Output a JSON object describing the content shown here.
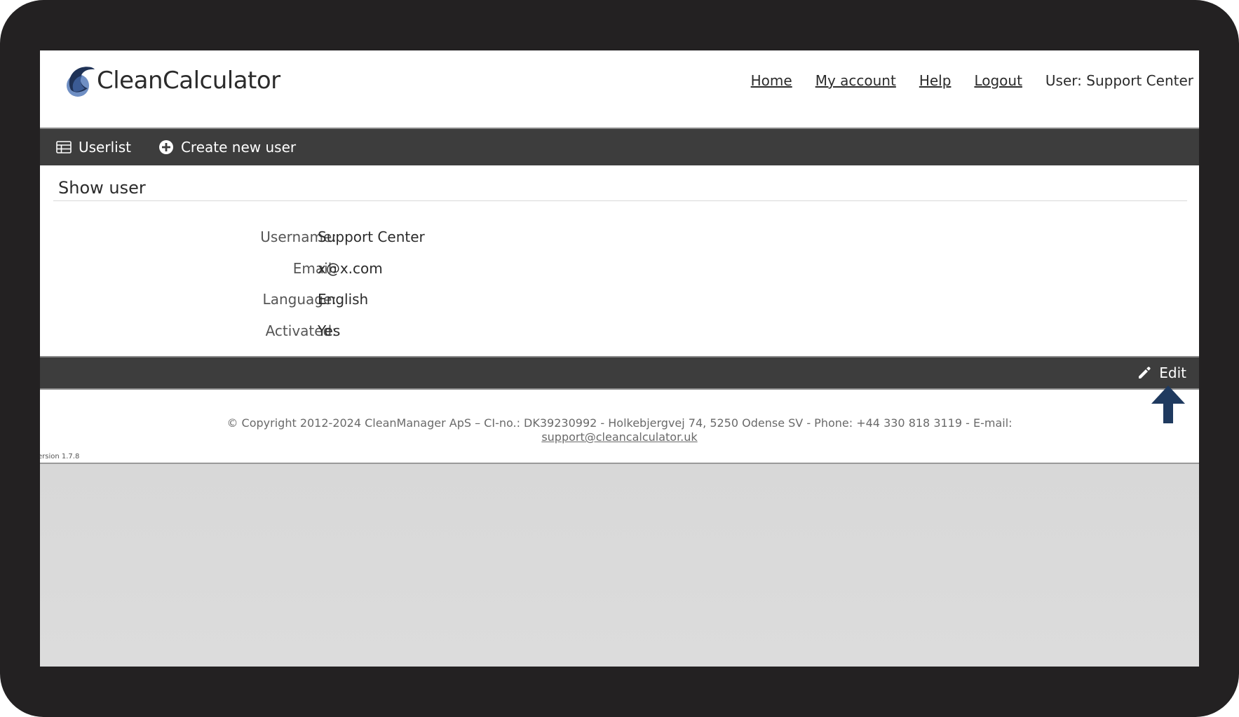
{
  "header": {
    "logo_text": "CleanCalculator",
    "nav": {
      "home": "Home",
      "my_account": "My account",
      "help": "Help",
      "logout": "Logout"
    },
    "current_user": "User: Support Center"
  },
  "toolbar": {
    "userlist_label": "Userlist",
    "userlist_icon": "table-icon",
    "create_label": "Create new user",
    "create_icon": "plus-circle-icon"
  },
  "main": {
    "title": "Show user",
    "fields": [
      {
        "label": "Username:",
        "value": "Support Center"
      },
      {
        "label": "Email:",
        "value": "x@x.com"
      },
      {
        "label": "Language:",
        "value": "English"
      },
      {
        "label": "Activated:",
        "value": "Yes"
      }
    ]
  },
  "actions": {
    "edit_label": "Edit",
    "edit_icon": "pencil-icon"
  },
  "footer": {
    "copyright": "© Copyright 2012-2024 CleanManager ApS – CI-no.: DK39230992 - Holkebjergvej 74, 5250 Odense SV - Phone: +44 330 818 3119 - E-mail:",
    "email": "support@cleancalculator.uk",
    "version": "ersion 1.7.8"
  },
  "colors": {
    "bezel": "#232122",
    "toolbar_bg": "#3d3d3d",
    "annotation_arrow": "#1f3a5f"
  }
}
